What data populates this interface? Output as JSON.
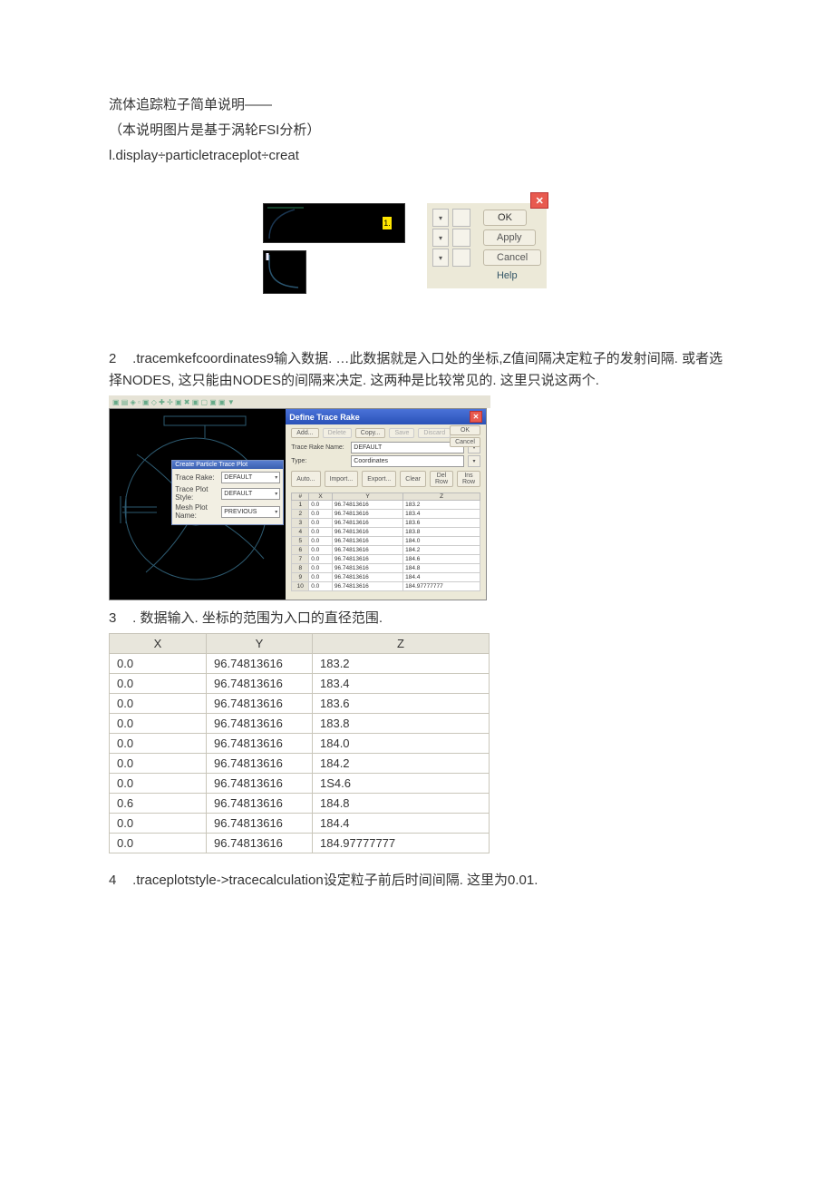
{
  "intro": {
    "line1": "流体追踪粒子简单说明——",
    "line2": "（本说明图片是基于涡轮FSI分析）",
    "line3": "l.display÷particletraceplot÷creat"
  },
  "fig1": {
    "marker": "1.",
    "buttons": {
      "ok": "OK",
      "apply": "Apply",
      "cancel": "Cancel",
      "help": "Help"
    }
  },
  "section2": {
    "num": "2",
    "text": ".tracemkefcoordinates9输入数据. …此数据就是入口处的坐标,Z值间隔决定粒子的发射间隔. 或者选择NODES, 这只能由NODES的间隔来决定. 这两种是比较常见的. 这里只说这两个."
  },
  "fig2_toolbar": "▣ ▤ ◈  ▫ ▣ ◇ ✚ ✢ ▣ ✖ ▣ ▢  ▣ ▣ ▼",
  "fig2_left_panel": {
    "title": "Create Particle Trace Plot",
    "rows": [
      {
        "label": "Trace Rake:",
        "value": "DEFAULT"
      },
      {
        "label": "Trace Plot Style:",
        "value": "DEFAULT"
      },
      {
        "label": "Mesh Plot Name:",
        "value": "PREVIOUS"
      }
    ]
  },
  "fig2_dialog": {
    "title": "Define Trace Rake",
    "topButtons": {
      "add": "Add...",
      "del": "Delete",
      "copy": "Copy...",
      "save": "Save",
      "discard": "Discard"
    },
    "rightButtons": {
      "ok": "OK",
      "cancel": "Cancel"
    },
    "fields": {
      "name_label": "Trace Rake Name:",
      "name_value": "DEFAULT",
      "type_label": "Type:",
      "type_value": "Coordinates"
    },
    "toolbar": {
      "auto": "Auto...",
      "import": "Import...",
      "export": "Export...",
      "clear": "Clear",
      "delrow": "Del Row",
      "insrow": "Ins Row"
    },
    "headers": {
      "id": "#",
      "x": "X",
      "y": "Y",
      "z": "Z"
    },
    "rows": [
      {
        "id": "1",
        "x": "0.0",
        "y": "96.74813616",
        "z": "183.2"
      },
      {
        "id": "2",
        "x": "0.0",
        "y": "96.74813616",
        "z": "183.4"
      },
      {
        "id": "3",
        "x": "0.0",
        "y": "96.74813616",
        "z": "183.6"
      },
      {
        "id": "4",
        "x": "0.0",
        "y": "96.74813616",
        "z": "183.8"
      },
      {
        "id": "5",
        "x": "0.0",
        "y": "96.74813616",
        "z": "184.0"
      },
      {
        "id": "6",
        "x": "0.0",
        "y": "96.74813616",
        "z": "184.2"
      },
      {
        "id": "7",
        "x": "0.0",
        "y": "96.74813616",
        "z": "184.6"
      },
      {
        "id": "8",
        "x": "0.0",
        "y": "96.74813616",
        "z": "184.8"
      },
      {
        "id": "9",
        "x": "0.0",
        "y": "96.74813616",
        "z": "184.4"
      },
      {
        "id": "10",
        "x": "0.0",
        "y": "96.74813616",
        "z": "184.97777777"
      }
    ]
  },
  "section3": {
    "num": "3",
    "text": ". 数据输入. 坐标的范围为入口的直径范围."
  },
  "big_table": {
    "headers": {
      "x": "X",
      "y": "Y",
      "z": "Z"
    },
    "rows": [
      {
        "x": "0.0",
        "y": "96.74813616",
        "z": "183.2"
      },
      {
        "x": "0.0",
        "y": "96.74813616",
        "z": "183.4"
      },
      {
        "x": "0.0",
        "y": "96.74813616",
        "z": "183.6"
      },
      {
        "x": "0.0",
        "y": "96.74813616",
        "z": "183.8"
      },
      {
        "x": "0.0",
        "y": "96.74813616",
        "z": "184.0"
      },
      {
        "x": "0.0",
        "y": "96.74813616",
        "z": "184.2"
      },
      {
        "x": "0.0",
        "y": "96.74813616",
        "z": "1S4.6"
      },
      {
        "x": "0.6",
        "y": "96.74813616",
        "z": "184.8"
      },
      {
        "x": "0.0",
        "y": "96.74813616",
        "z": "184.4"
      },
      {
        "x": "0.0",
        "y": "96.74813616",
        "z": "184.97777777"
      }
    ]
  },
  "section4": {
    "num": "4",
    "text": ".traceplotstyle->tracecalculation设定粒子前后时间间隔. 这里为0.01."
  }
}
